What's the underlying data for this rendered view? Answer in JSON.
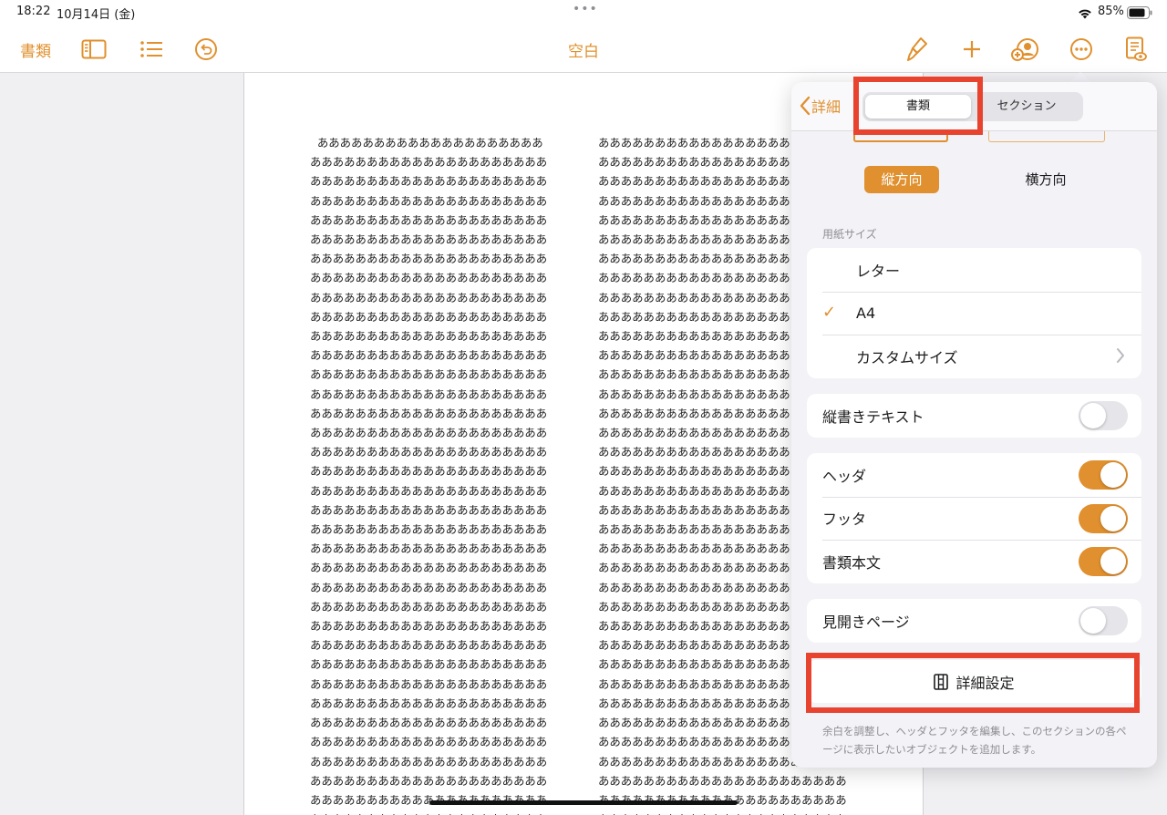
{
  "status_bar": {
    "time": "18:22",
    "date": "10月14日 (金)",
    "dots": "•••",
    "battery_pct": "85%",
    "battery_level": 0.85
  },
  "toolbar": {
    "docs_label": "書類",
    "title": "空白",
    "icons": [
      "sidebar-icon",
      "list-icon",
      "undo-icon",
      "paintbrush-icon",
      "plus-icon",
      "collaborate-icon",
      "more-icon",
      "document-view-icon"
    ]
  },
  "document": {
    "left_column": "  ああああああああああああああああああああ\nあああああああああああああああああああああ\nあああああああああああああああああああああ\nあああああああああああああああああああああ\nあああああああああああああああああああああ\nあああああああああああああああああああああ\nあああああああああああああああああああああ\nあああああああああああああああああああああ\nあああああああああああああああああああああ\nあああああああああああああああああああああ\nあああああああああああああああああああああ\nあああああああああああああああああああああ\nあああああああああああああああああああああ\nあああああああああああああああああああああ\nあああああああああああああああああああああ\nあああああああああああああああああああああ\nあああああああああああああああああああああ\nあああああああああああああああああああああ\nあああああああああああああああああああああ\nあああああああああああああああああああああ\nあああああああああああああああああああああ\nあああああああああああああああああああああ\nあああああああああああああああああああああ\nあああああああああああああああああああああ\nあああああああああああああああああああああ\nあああああああああああああああああああああ\nあああああああああああああああああああああ\nあああああああああああああああああああああ\nあああああああああああああああああああああ\nあああああああああああああああああああああ\nあああああああああああああああああああああ\nあああああああああああああああああああああ\nあああああああああああああああああああああ\nあああああああああああああああああああああ\nあああああああああああああああああああああ\nあああああああああああああああああああああ\nあああああああああああああああああああああ",
    "right_column": "ああああああああああああああああああああああ\nああああああああああああああああああああああ\nああああああああああああああああああああああ\nああああああああああああああああああああああ\nああああああああああああああああああああああ\nああああああああああああああああああああああ\nああああああああああああああああああああああ\nああああああああああああああああああああああ\nああああああああああああああああああああああ\nああああああああああああああああああああああ\nああああああああああああああああああああああ\nああああああああああああああああああああああ\nああああああああああああああああああああああ\nああああああああああああああああああああああ\nああああああああああああああああああああああ\nああああああああああああああああああああああ\nああああああああああああああああああああああ\nああああああああああああああああああああああ\nああああああああああああああああああああああ\nああああああああああああああああああああああ\nああああああああああああああああああああああ\nああああああああああああああああああああああ\nああああああああああああああああああああああ\nああああああああああああああああああああああ\nああああああああああああああああああああああ\nああああああああああああああああああああああ\nああああああああああああああああああああああ\nああああああああああああああああああああああ\nああああああああああああああああああああああ\nああああああああああああああああああああああ\nああああああああああああああああああああああ\nああああああああああああああああああああああ\nああああああああああああああああああああああ\nああああああああああああああああああああああ\nああああああああああああああああああああああ\nああああああああああああああああああああああ\nああああああああああああああああああああああああ"
  },
  "popover": {
    "back_label": "詳細",
    "tabs": [
      {
        "label": "書類",
        "active": true
      },
      {
        "label": "セクション",
        "active": false
      }
    ],
    "orientation": {
      "portrait": "縦方向",
      "landscape": "横方向",
      "selected": "portrait"
    },
    "paper_size": {
      "section_label": "用紙サイズ",
      "options": [
        "レター",
        "A4",
        "カスタムサイズ"
      ],
      "selected": "A4",
      "check_glyph": "✓"
    },
    "vertical_text": {
      "label": "縦書きテキスト",
      "on": false
    },
    "toggles": [
      {
        "label": "ヘッダ",
        "on": true
      },
      {
        "label": "フッタ",
        "on": true
      },
      {
        "label": "書類本文",
        "on": true
      }
    ],
    "facing_pages": {
      "label": "見開きページ",
      "on": false
    },
    "advanced_button": "詳細設定",
    "footnote": "余白を調整し、ヘッダとフッタを編集し、このセクションの各ページに表示したいオブジェクトを追加します。"
  },
  "colors": {
    "accent": "#e0902e",
    "highlight": "#e8432f",
    "toggle_off": "#e5e5ea"
  }
}
